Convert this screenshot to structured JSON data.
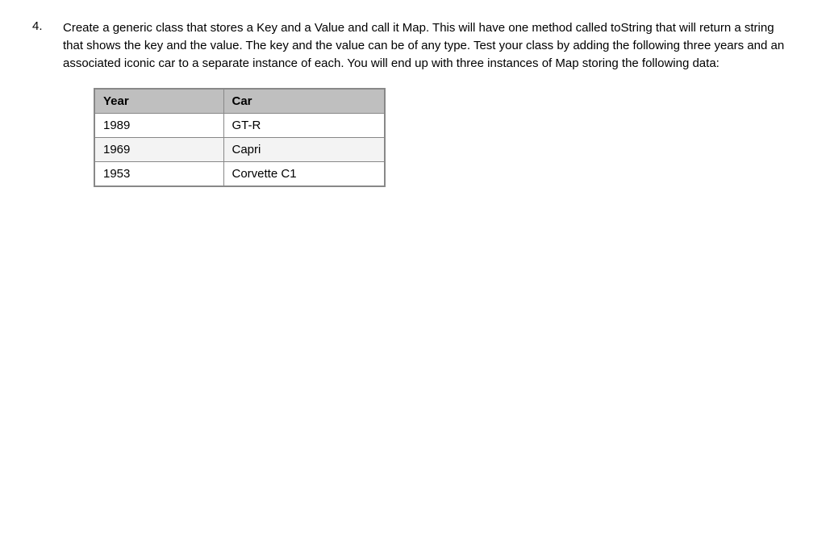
{
  "question": {
    "number": "4.",
    "text": "Create a generic class that stores a Key and a Value and call it Map.  This will have one method called toString that will return a string that shows the key and the value.  The key and the value can be of any type.  Test your class by adding the following three years and an associated iconic car to a separate instance of each.  You will end up with three instances of Map storing the following data:"
  },
  "table": {
    "headers": {
      "col1": "Year",
      "col2": "Car"
    },
    "rows": [
      {
        "year": "1989",
        "car": "GT-R"
      },
      {
        "year": "1969",
        "car": "Capri"
      },
      {
        "year": "1953",
        "car": "Corvette C1"
      }
    ]
  }
}
